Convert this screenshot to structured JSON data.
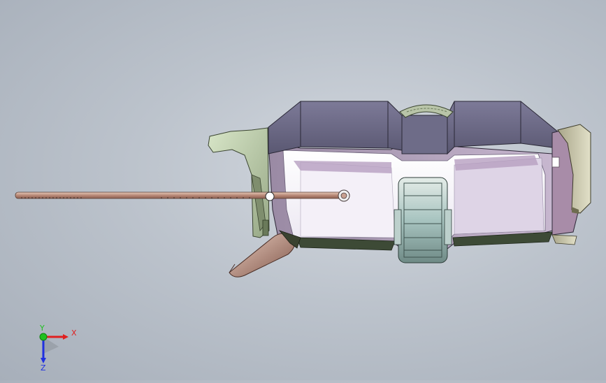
{
  "viewport": {
    "background_color": "#b6bdc7",
    "model": {
      "parts": [
        "housing",
        "left-bracket",
        "threaded-rod",
        "roller-wheel",
        "nozzle-tip",
        "end-cap",
        "top-gear"
      ]
    }
  },
  "triad": {
    "x_label": "X",
    "y_label": "Y",
    "z_label": "Z",
    "colors": {
      "x": "#e02020",
      "y": "#20c020",
      "z": "#2030e0"
    }
  }
}
